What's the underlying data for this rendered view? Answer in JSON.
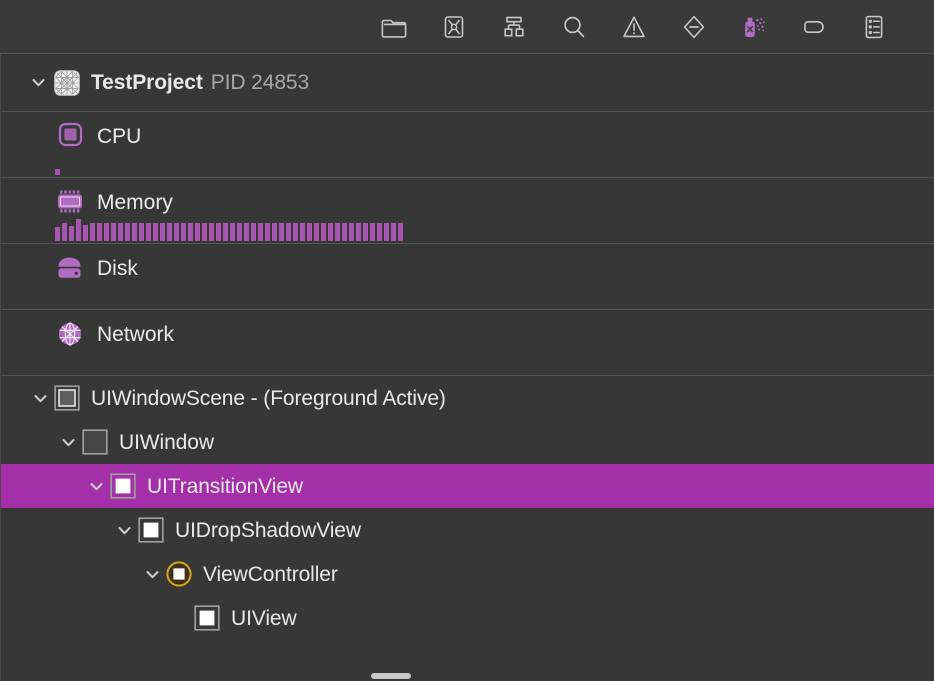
{
  "window": {
    "background_color": "#373737",
    "separator_color": "#545454",
    "selection_color": "#a330a9",
    "accent_purple": "#b06cc0",
    "highlight_yellow": "#d8a520"
  },
  "toolbar": {
    "items": [
      {
        "name": "document-icon",
        "label": "Show Document Outline"
      },
      {
        "name": "views-snapshot-icon",
        "label": "Capture View Hierarchy"
      },
      {
        "name": "hierarchy-icon",
        "label": "Show View Hierarchy"
      },
      {
        "name": "search-icon",
        "label": "Search"
      },
      {
        "name": "warning-icon",
        "label": "Issues"
      },
      {
        "name": "diamond-minus-icon",
        "label": "Breakpoints"
      },
      {
        "name": "memory-graph-icon",
        "label": "Debug Memory Graph"
      },
      {
        "name": "tag-icon",
        "label": "Labels"
      },
      {
        "name": "list-icon",
        "label": "Show Debug Area"
      }
    ]
  },
  "process": {
    "name": "TestProject",
    "pid_label": "PID 24853",
    "expanded": true,
    "icon": "project-grid-icon"
  },
  "resources": [
    {
      "label": "CPU",
      "icon": "cpu-chip-icon",
      "graph_type": "bar",
      "bar_count": 1,
      "bars": [
        22
      ]
    },
    {
      "label": "Memory",
      "icon": "memory-chip-icon",
      "graph_type": "bar",
      "bar_count": 50,
      "bars": [
        52,
        70,
        58,
        86,
        62,
        70,
        70,
        70,
        68,
        70,
        70,
        70,
        70,
        70,
        70,
        68,
        70,
        70,
        70,
        70,
        70,
        70,
        68,
        70,
        70,
        70,
        70,
        70,
        70,
        68,
        70,
        70,
        70,
        70,
        70,
        68,
        70,
        70,
        70,
        70,
        70,
        68,
        70,
        70,
        70,
        70,
        70,
        70,
        68,
        70
      ]
    },
    {
      "label": "Disk",
      "icon": "disk-drive-icon",
      "graph_type": "none",
      "bar_count": 0,
      "bars": []
    },
    {
      "label": "Network",
      "icon": "network-globe-icon",
      "graph_type": "none",
      "bar_count": 0,
      "bars": []
    }
  ],
  "hierarchy": [
    {
      "label": "UIWindowScene - (Foreground Active)",
      "icon": "scene-square-icon",
      "indent": 1,
      "expanded": true,
      "selected": false,
      "has_children": true
    },
    {
      "label": "UIWindow",
      "icon": "empty-square-icon",
      "indent": 2,
      "expanded": true,
      "selected": false,
      "has_children": true
    },
    {
      "label": "UITransitionView",
      "icon": "view-square-icon",
      "indent": 3,
      "expanded": true,
      "selected": true,
      "has_children": true
    },
    {
      "label": "UIDropShadowView",
      "icon": "view-square-icon",
      "indent": 4,
      "expanded": true,
      "selected": false,
      "has_children": true
    },
    {
      "label": "ViewController",
      "icon": "view-controller-circle-icon",
      "indent": 5,
      "expanded": true,
      "selected": false,
      "has_children": true
    },
    {
      "label": "UIView",
      "icon": "view-square-icon",
      "indent": 6,
      "expanded": false,
      "selected": false,
      "has_children": false
    }
  ]
}
